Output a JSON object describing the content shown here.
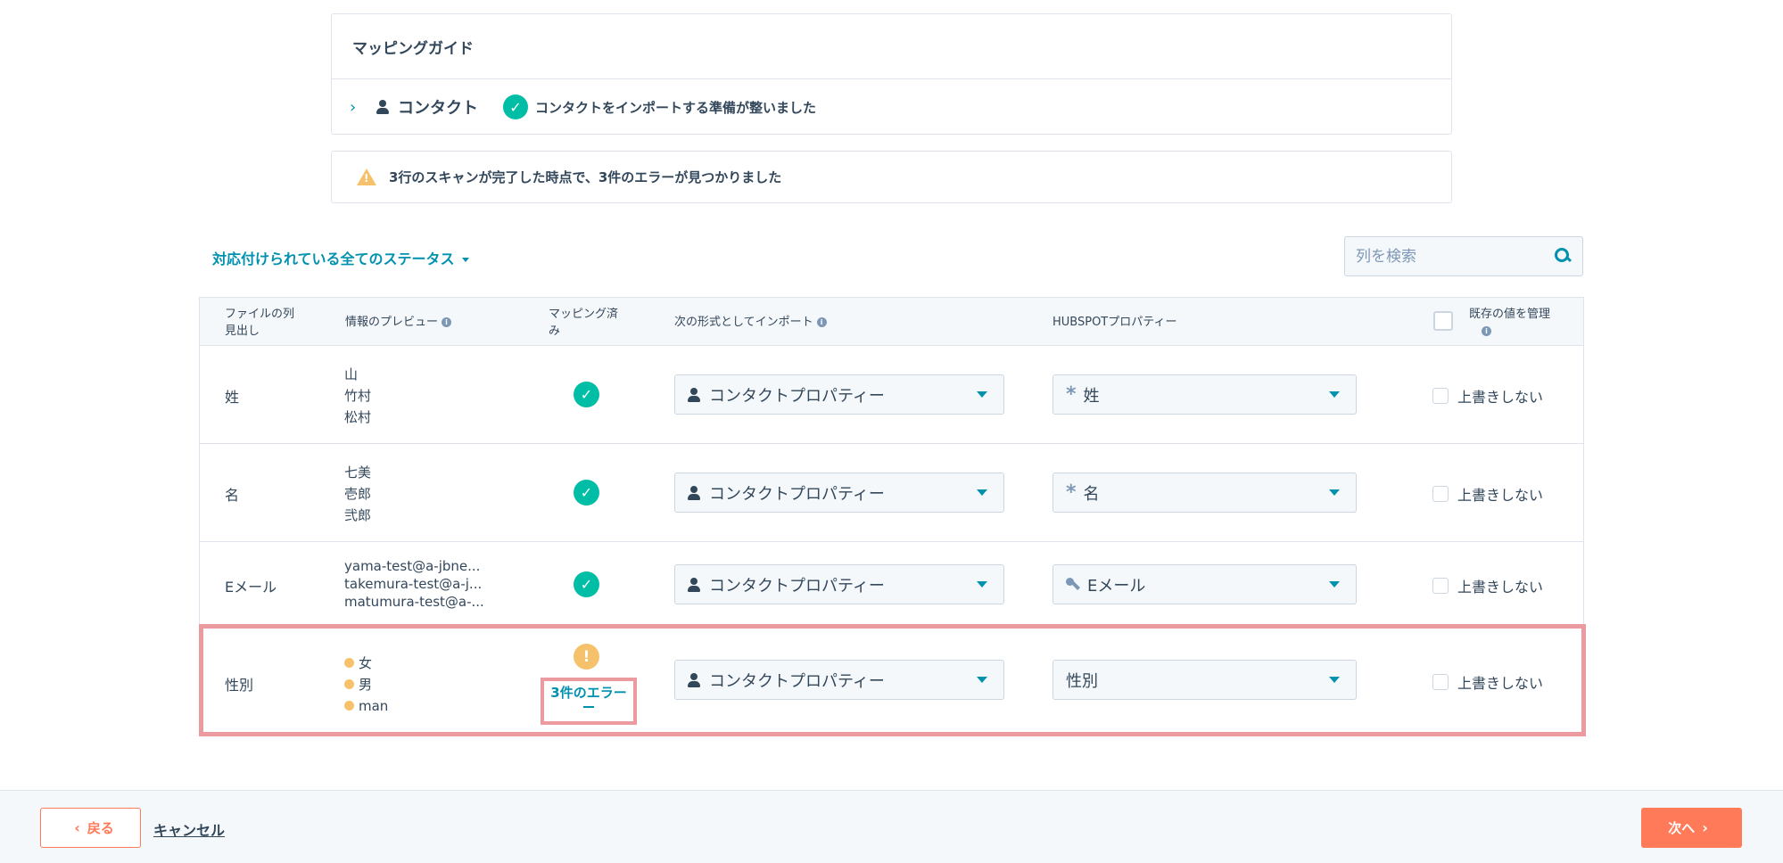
{
  "guide": {
    "title": "マッピングガイド",
    "object": "コンタクト",
    "status": "コンタクトをインポートする準備が整いました"
  },
  "warning": {
    "text": "3行のスキャンが完了した時点で、3件のエラーが見つかりました"
  },
  "filter": {
    "label": "対応付けられている全てのステータス"
  },
  "search": {
    "placeholder": "列を検索"
  },
  "table": {
    "headers": {
      "file_column_line1": "ファイルの列",
      "file_column_line2": "見出し",
      "preview": "情報のプレビュー",
      "mapped_line1": "マッピング済",
      "mapped_line2": "み",
      "import_as": "次の形式としてインポート",
      "property": "HUBSPOTプロパティー",
      "manage_line1": "既存の値を管理"
    },
    "rows": [
      {
        "column": "姓",
        "preview": [
          "山",
          "竹村",
          "松村"
        ],
        "import_as": "コンタクトプロパティー",
        "property": "姓",
        "overwrite": "上書きしない"
      },
      {
        "column": "名",
        "preview": [
          "七美",
          "壱郎",
          "弐郎"
        ],
        "import_as": "コンタクトプロパティー",
        "property": "名",
        "overwrite": "上書きしない"
      },
      {
        "column": "Eメール",
        "preview": [
          "yama-test@a-jbne...",
          "takemura-test@a-j...",
          "matumura-test@a-..."
        ],
        "import_as": "コンタクトプロパティー",
        "property": "Eメール",
        "overwrite": "上書きしない"
      },
      {
        "column": "性別",
        "preview": [
          "女",
          "男",
          "man"
        ],
        "import_as": "コンタクトプロパティー",
        "property": "性別",
        "overwrite": "上書きしない",
        "errors": "3件のエラー"
      }
    ]
  },
  "footer": {
    "back": "戻る",
    "cancel": "キャンセル",
    "next": "次へ"
  },
  "colors": {
    "accent": "#0091ae",
    "success": "#00bda5",
    "warning": "#f5c26b",
    "cta": "#ff7a59",
    "highlight": "#eb9a9f"
  }
}
